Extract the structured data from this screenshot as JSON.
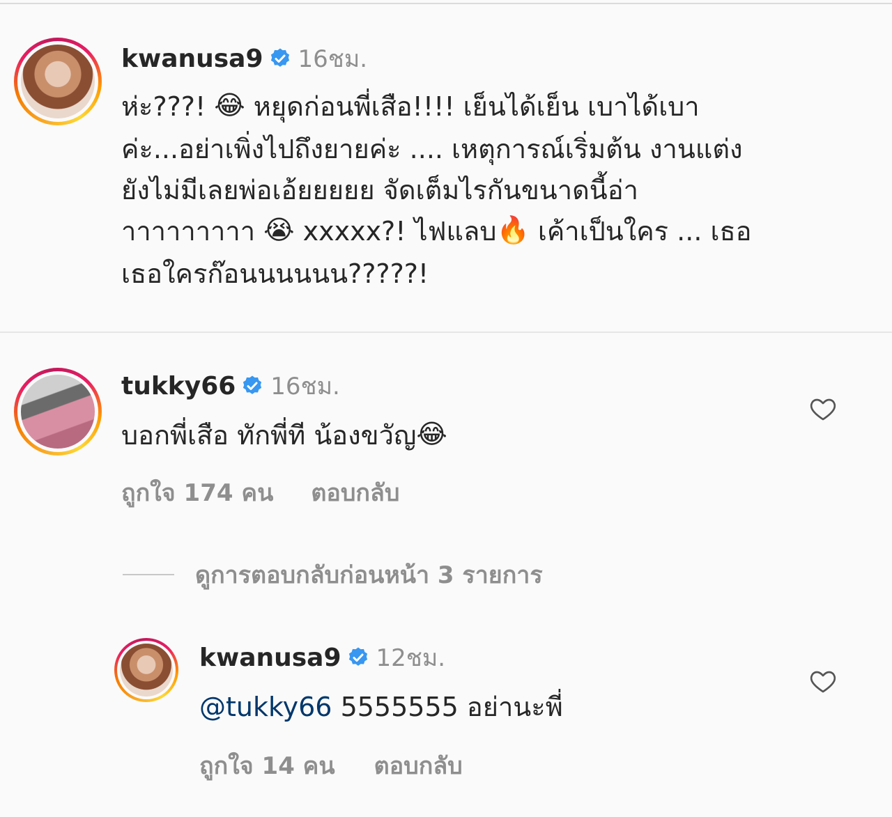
{
  "comments": [
    {
      "username": "kwanusa9",
      "time": "16ชม.",
      "text_lines": [
        [
          "ห่ะ???! ",
          "😂",
          " หยุดก่อนพี่เสือ!!!! เย็นได้เย็น เบาได้เบา"
        ],
        [
          "ค่ะ...อย่าเพิ่งไปถึงยายค่ะ .... เหตุการณ์เริ่มต้น งานแต่ง"
        ],
        [
          "ยังไม่มีเลยพ่อเอ้ยยยยย จัดเต็มไรกันขนาดนี้อ่า"
        ],
        [
          "าาาาาาาาา ",
          "😭",
          " xxxxx?! ไฟแลบ",
          "🔥",
          " เค้าเป็นใคร ... เธอ"
        ],
        [
          "เธอใครก๊อนนนนนน?????!"
        ]
      ]
    },
    {
      "username": "tukky66",
      "time": "16ชม.",
      "text": "บอกพี่เสือ ทักพี่ที น้องขวัญ",
      "emoji": "😂",
      "likes": "ถูกใจ 174 คน",
      "reply": "ตอบกลับ"
    }
  ],
  "view_replies": "ดูการตอบกลับก่อนหน้า 3 รายการ",
  "reply_comment": {
    "username": "kwanusa9",
    "time": "12ชม.",
    "mention": "@tukky66",
    "text": " 5555555 อย่านะพี่",
    "likes": "ถูกใจ 14 คน",
    "reply": "ตอบกลับ"
  },
  "icons": {
    "verified": "verified-badge-icon",
    "heart": "heart-outline-icon"
  },
  "colors": {
    "verified": "#3897f0",
    "mention": "#00376b",
    "muted": "#8e8e8e"
  }
}
